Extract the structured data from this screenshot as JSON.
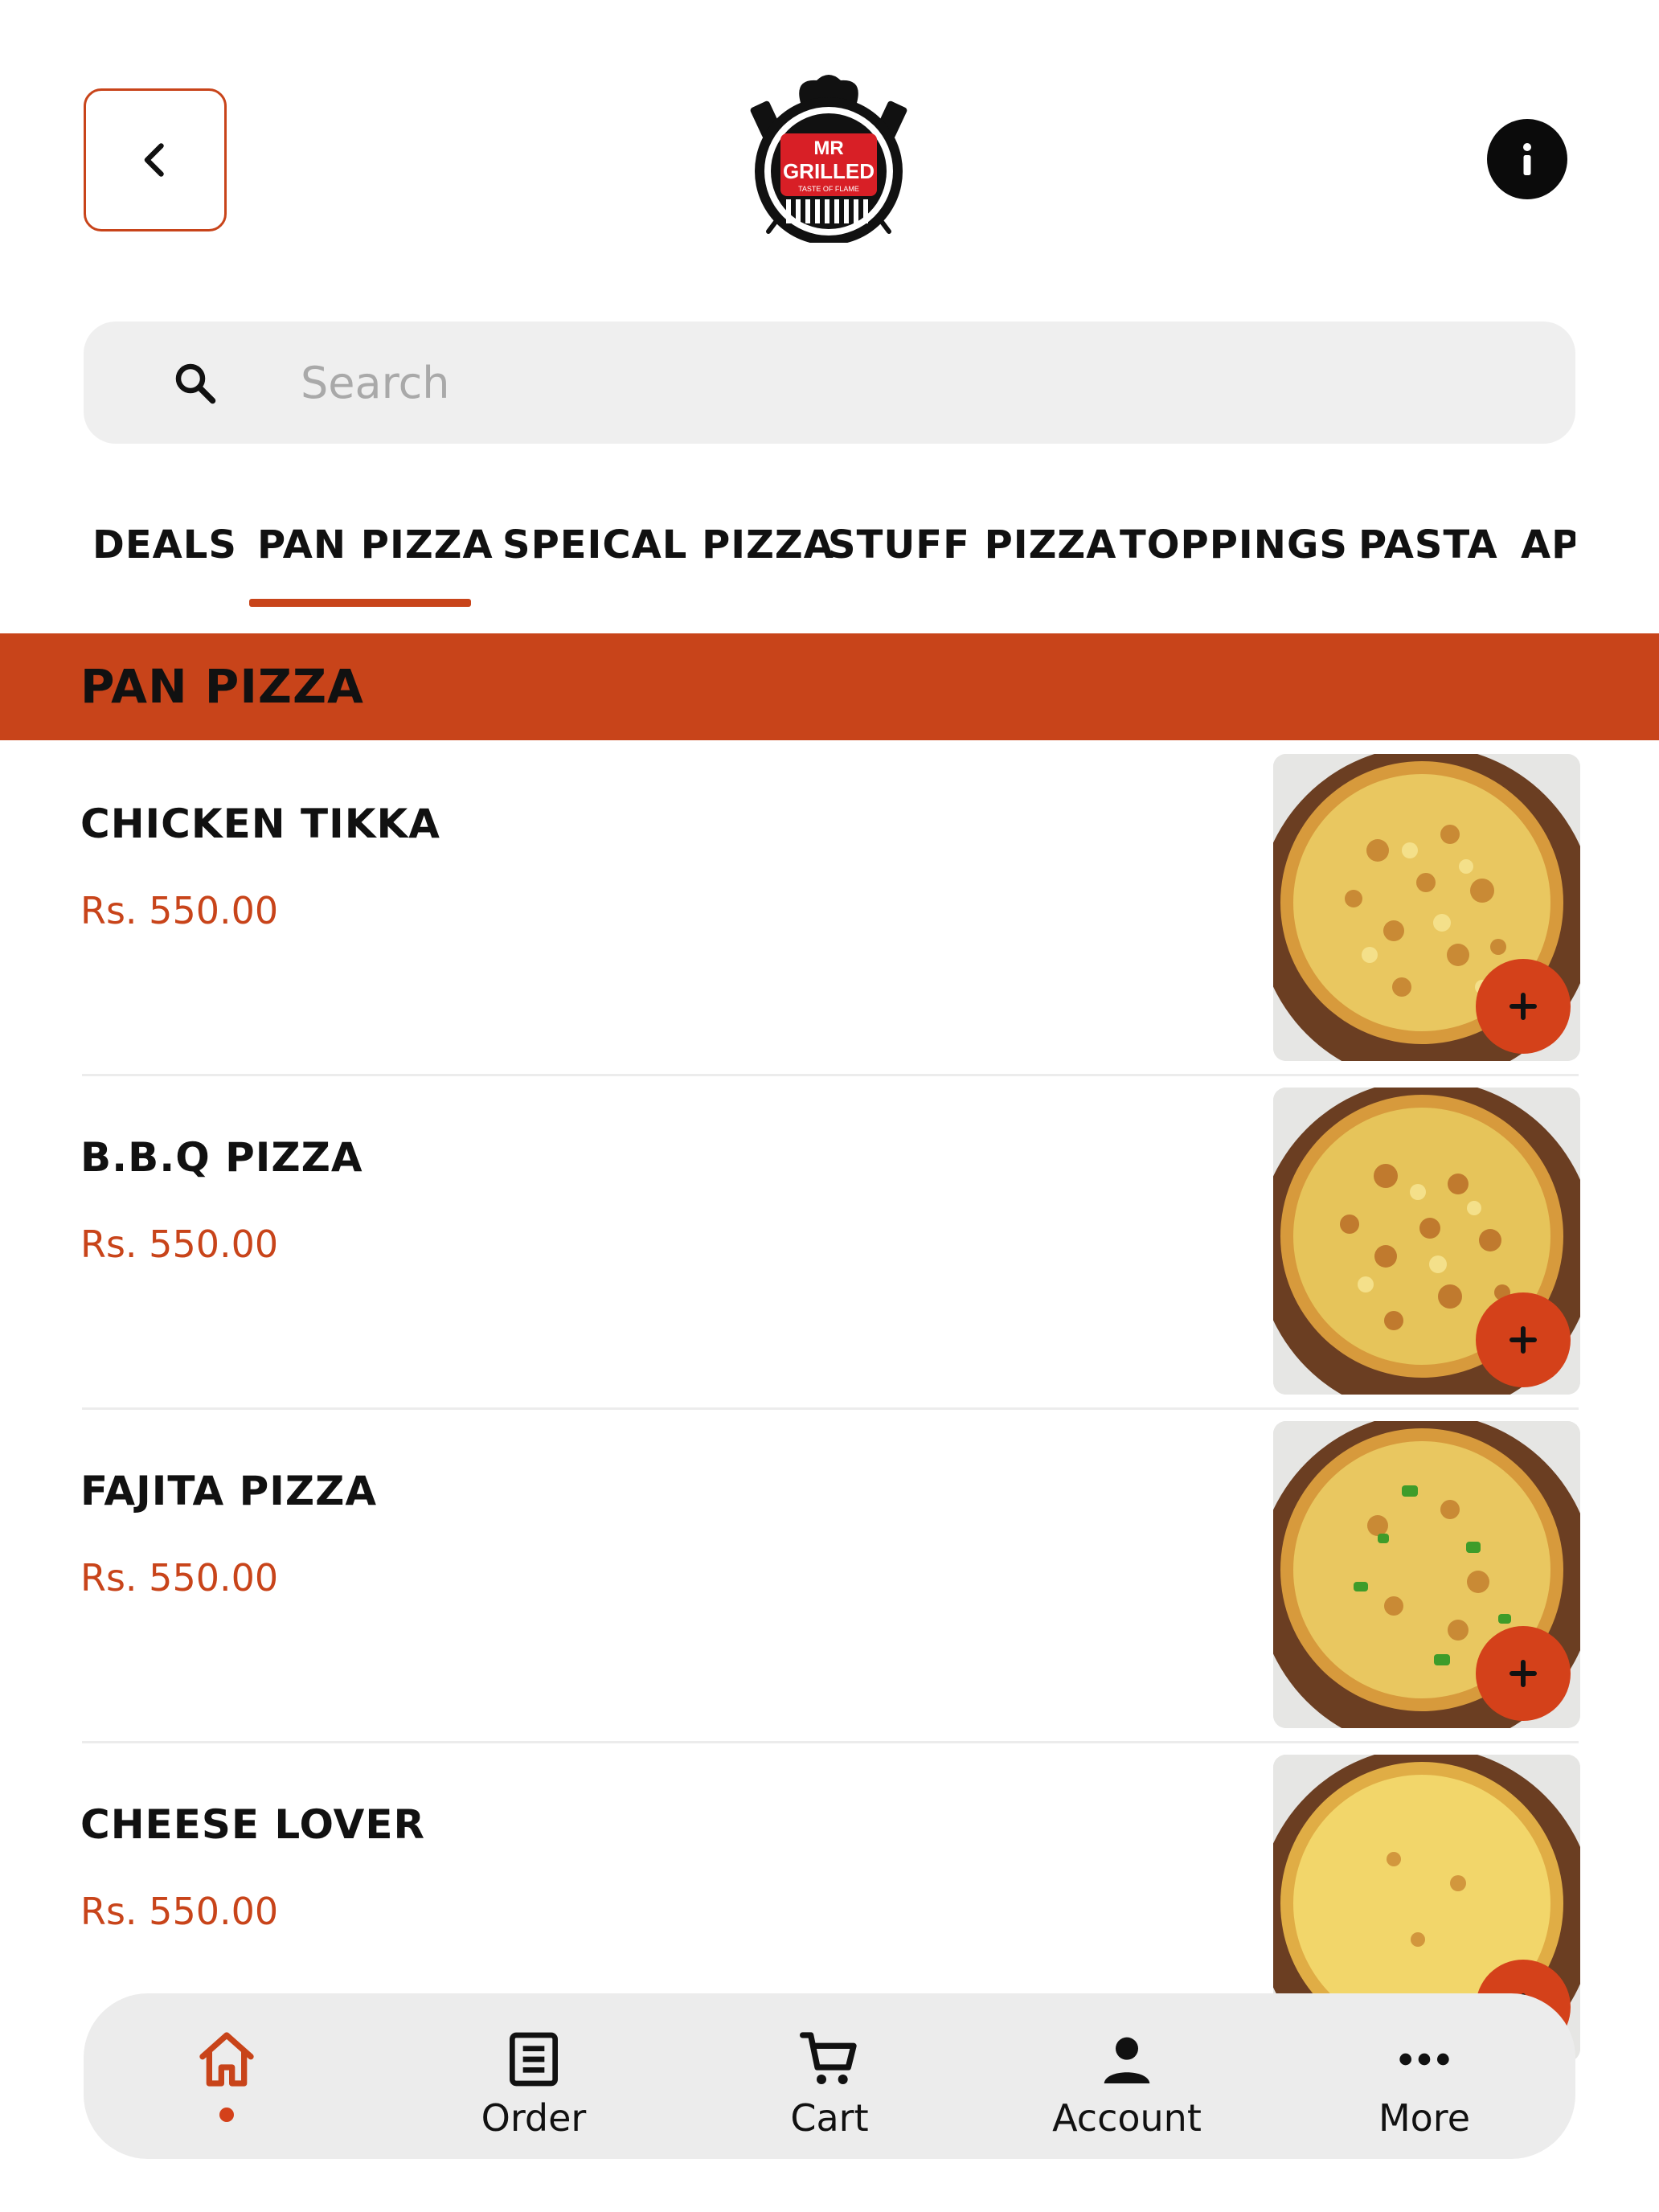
{
  "header": {
    "back_icon": "chevron-left-icon",
    "logo": {
      "text_line1": "MR",
      "text_line2": "GRILLED",
      "tagline": "TASTE OF FLAME"
    },
    "info_icon": "info-icon"
  },
  "search": {
    "placeholder": "Search",
    "value": ""
  },
  "tabs": {
    "items": [
      {
        "label": "DEALS"
      },
      {
        "label": "PAN PIZZA",
        "active": true
      },
      {
        "label": "SPEICAL PIZZA"
      },
      {
        "label": "STUFF PIZZA"
      },
      {
        "label": "TOPPINGS"
      },
      {
        "label": "PASTA"
      },
      {
        "label": "API"
      }
    ]
  },
  "section": {
    "title": "PAN PIZZA"
  },
  "items": [
    {
      "name": "CHICKEN TIKKA",
      "price": "Rs. 550.00"
    },
    {
      "name": "B.B.Q PIZZA",
      "price": "Rs. 550.00"
    },
    {
      "name": "FAJITA PIZZA",
      "price": "Rs. 550.00"
    },
    {
      "name": "CHEESE LOVER",
      "price": "Rs. 550.00"
    }
  ],
  "bottom_nav": {
    "items": [
      {
        "label": "",
        "icon": "home-icon",
        "active": true
      },
      {
        "label": "Order",
        "icon": "order-list-icon"
      },
      {
        "label": "Cart",
        "icon": "cart-icon"
      },
      {
        "label": "Account",
        "icon": "account-icon"
      },
      {
        "label": "More",
        "icon": "more-icon"
      }
    ]
  },
  "colors": {
    "accent": "#c8441a",
    "add_button": "#d4411a",
    "search_bg": "#efefef",
    "nav_bg": "#ececec"
  }
}
